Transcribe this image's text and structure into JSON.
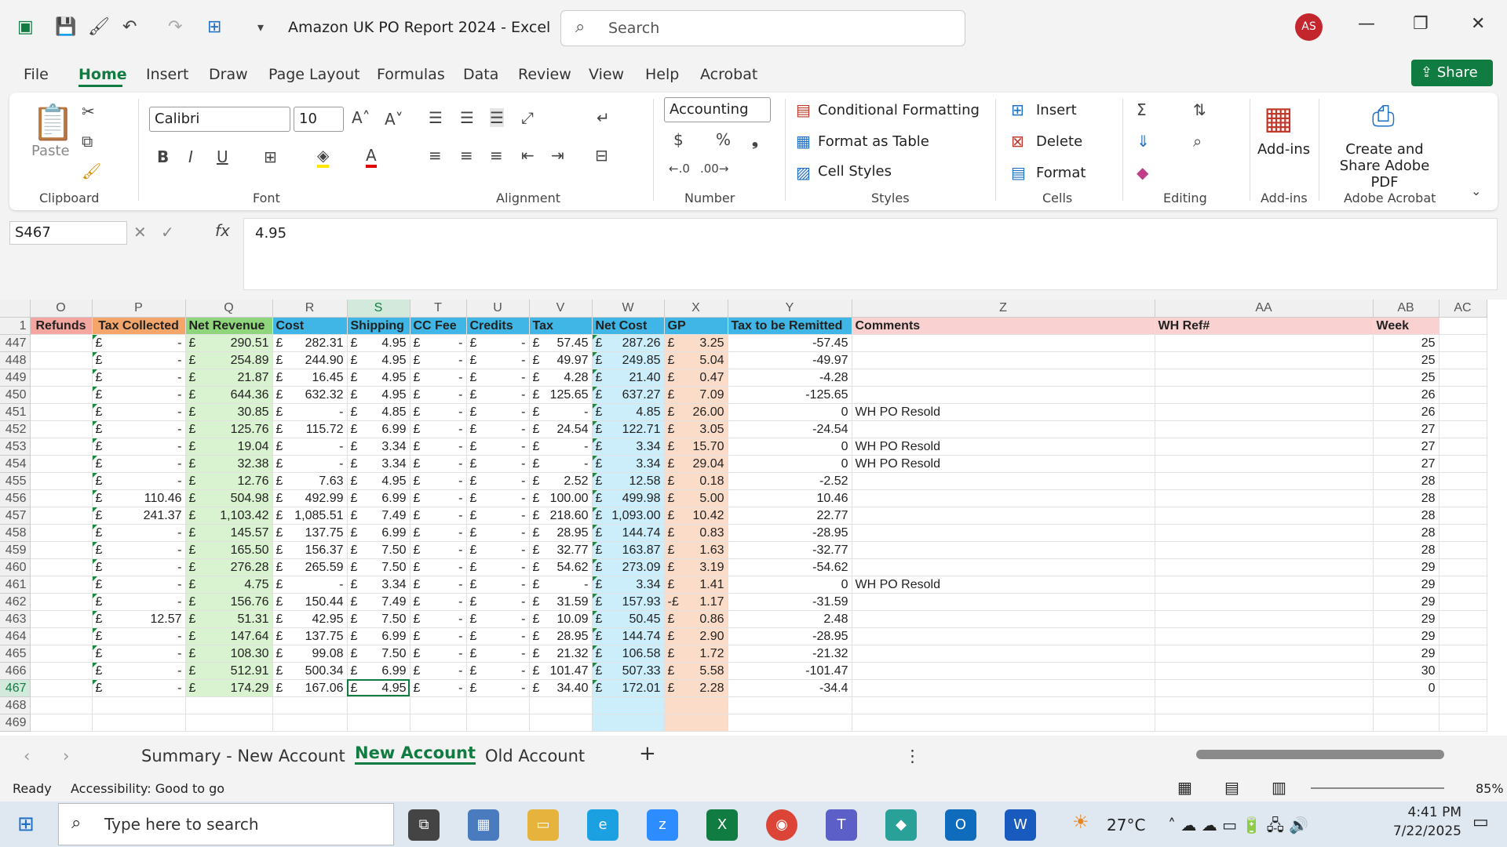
{
  "title": {
    "doc": "Amazon UK PO Report 2024  -  Excel",
    "search": "Search",
    "avatar": "AS"
  },
  "menu": [
    "File",
    "Home",
    "Insert",
    "Draw",
    "Page Layout",
    "Formulas",
    "Data",
    "Review",
    "View",
    "Help",
    "Acrobat"
  ],
  "share": "Share",
  "ribbon": {
    "paste": "Paste",
    "font": "Calibri",
    "size": "10",
    "number_format": "Accounting",
    "cond": "Conditional Formatting",
    "fmt_table": "Format as Table",
    "cell_styles": "Cell Styles",
    "insert": "Insert",
    "delete": "Delete",
    "format": "Format",
    "addins": "Add-ins",
    "acrobat": "Create and Share Adobe PDF",
    "groups": [
      "Clipboard",
      "Font",
      "Alignment",
      "Number",
      "Styles",
      "Cells",
      "Editing",
      "Add-ins",
      "Adobe Acrobat"
    ]
  },
  "namebox": "S467",
  "formula": "4.95",
  "columns": [
    "O",
    "P",
    "Q",
    "R",
    "S",
    "T",
    "U",
    "V",
    "W",
    "X",
    "Y",
    "Z",
    "AA",
    "AB",
    "AC"
  ],
  "headers": [
    "Refunds",
    "Tax Collected",
    "Net Revenue",
    "Cost",
    "Shipping",
    "CC Fee",
    "Credits",
    "Tax",
    "Net Cost",
    "GP",
    "Tax to be Remitted",
    "Comments",
    "WH Ref#",
    "Week"
  ],
  "rows": [
    [
      "447",
      "-",
      "290.51",
      "282.31",
      "4.95",
      "-",
      "-",
      "57.45",
      "287.26",
      "3.25",
      "-57.45",
      "",
      "25"
    ],
    [
      "448",
      "-",
      "254.89",
      "244.90",
      "4.95",
      "-",
      "-",
      "49.97",
      "249.85",
      "5.04",
      "-49.97",
      "",
      "25"
    ],
    [
      "449",
      "-",
      "21.87",
      "16.45",
      "4.95",
      "-",
      "-",
      "4.28",
      "21.40",
      "0.47",
      "-4.28",
      "",
      "25"
    ],
    [
      "450",
      "-",
      "644.36",
      "632.32",
      "4.95",
      "-",
      "-",
      "125.65",
      "637.27",
      "7.09",
      "-125.65",
      "",
      "26"
    ],
    [
      "451",
      "-",
      "30.85",
      "-",
      "4.85",
      "-",
      "-",
      "-",
      "4.85",
      "26.00",
      "0",
      "WH PO Resold",
      "26"
    ],
    [
      "452",
      "-",
      "125.76",
      "115.72",
      "6.99",
      "-",
      "-",
      "24.54",
      "122.71",
      "3.05",
      "-24.54",
      "",
      "27"
    ],
    [
      "453",
      "-",
      "19.04",
      "-",
      "3.34",
      "-",
      "-",
      "-",
      "3.34",
      "15.70",
      "0",
      "WH PO Resold",
      "27"
    ],
    [
      "454",
      "-",
      "32.38",
      "-",
      "3.34",
      "-",
      "-",
      "-",
      "3.34",
      "29.04",
      "0",
      "WH PO Resold",
      "27"
    ],
    [
      "455",
      "-",
      "12.76",
      "7.63",
      "4.95",
      "-",
      "-",
      "2.52",
      "12.58",
      "0.18",
      "-2.52",
      "",
      "28"
    ],
    [
      "456",
      "110.46",
      "504.98",
      "492.99",
      "6.99",
      "-",
      "-",
      "100.00",
      "499.98",
      "5.00",
      "10.46",
      "",
      "28"
    ],
    [
      "457",
      "241.37",
      "1,103.42",
      "1,085.51",
      "7.49",
      "-",
      "-",
      "218.60",
      "1,093.00",
      "10.42",
      "22.77",
      "",
      "28"
    ],
    [
      "458",
      "-",
      "145.57",
      "137.75",
      "6.99",
      "-",
      "-",
      "28.95",
      "144.74",
      "0.83",
      "-28.95",
      "",
      "28"
    ],
    [
      "459",
      "-",
      "165.50",
      "156.37",
      "7.50",
      "-",
      "-",
      "32.77",
      "163.87",
      "1.63",
      "-32.77",
      "",
      "28"
    ],
    [
      "460",
      "-",
      "276.28",
      "265.59",
      "7.50",
      "-",
      "-",
      "54.62",
      "273.09",
      "3.19",
      "-54.62",
      "",
      "29"
    ],
    [
      "461",
      "-",
      "4.75",
      "-",
      "3.34",
      "-",
      "-",
      "-",
      "3.34",
      "1.41",
      "0",
      "WH PO Resold",
      "29"
    ],
    [
      "462",
      "-",
      "156.76",
      "150.44",
      "7.49",
      "-",
      "-",
      "31.59",
      "157.93",
      "1.17",
      "-31.59",
      "",
      "29"
    ],
    [
      "463",
      "12.57",
      "51.31",
      "42.95",
      "7.50",
      "-",
      "-",
      "10.09",
      "50.45",
      "0.86",
      "2.48",
      "",
      "29"
    ],
    [
      "464",
      "-",
      "147.64",
      "137.75",
      "6.99",
      "-",
      "-",
      "28.95",
      "144.74",
      "2.90",
      "-28.95",
      "",
      "29"
    ],
    [
      "465",
      "-",
      "108.30",
      "99.08",
      "7.50",
      "-",
      "-",
      "21.32",
      "106.58",
      "1.72",
      "-21.32",
      "",
      "29"
    ],
    [
      "466",
      "-",
      "512.91",
      "500.34",
      "6.99",
      "-",
      "-",
      "101.47",
      "507.33",
      "5.58",
      "-101.47",
      "",
      "30"
    ],
    [
      "467",
      "-",
      "174.29",
      "167.06",
      "4.95",
      "-",
      "-",
      "34.40",
      "172.01",
      "2.28",
      "-34.4",
      "",
      "0"
    ]
  ],
  "tabs": [
    "Summary - New Account",
    "New Account",
    "Old Account"
  ],
  "status": {
    "ready": "Ready",
    "access": "Accessibility: Good to go",
    "zoom": "85%"
  },
  "taskbar": {
    "search": "Type here to search",
    "temp": "27°C",
    "time": "4:41 PM",
    "date": "7/22/2025"
  }
}
